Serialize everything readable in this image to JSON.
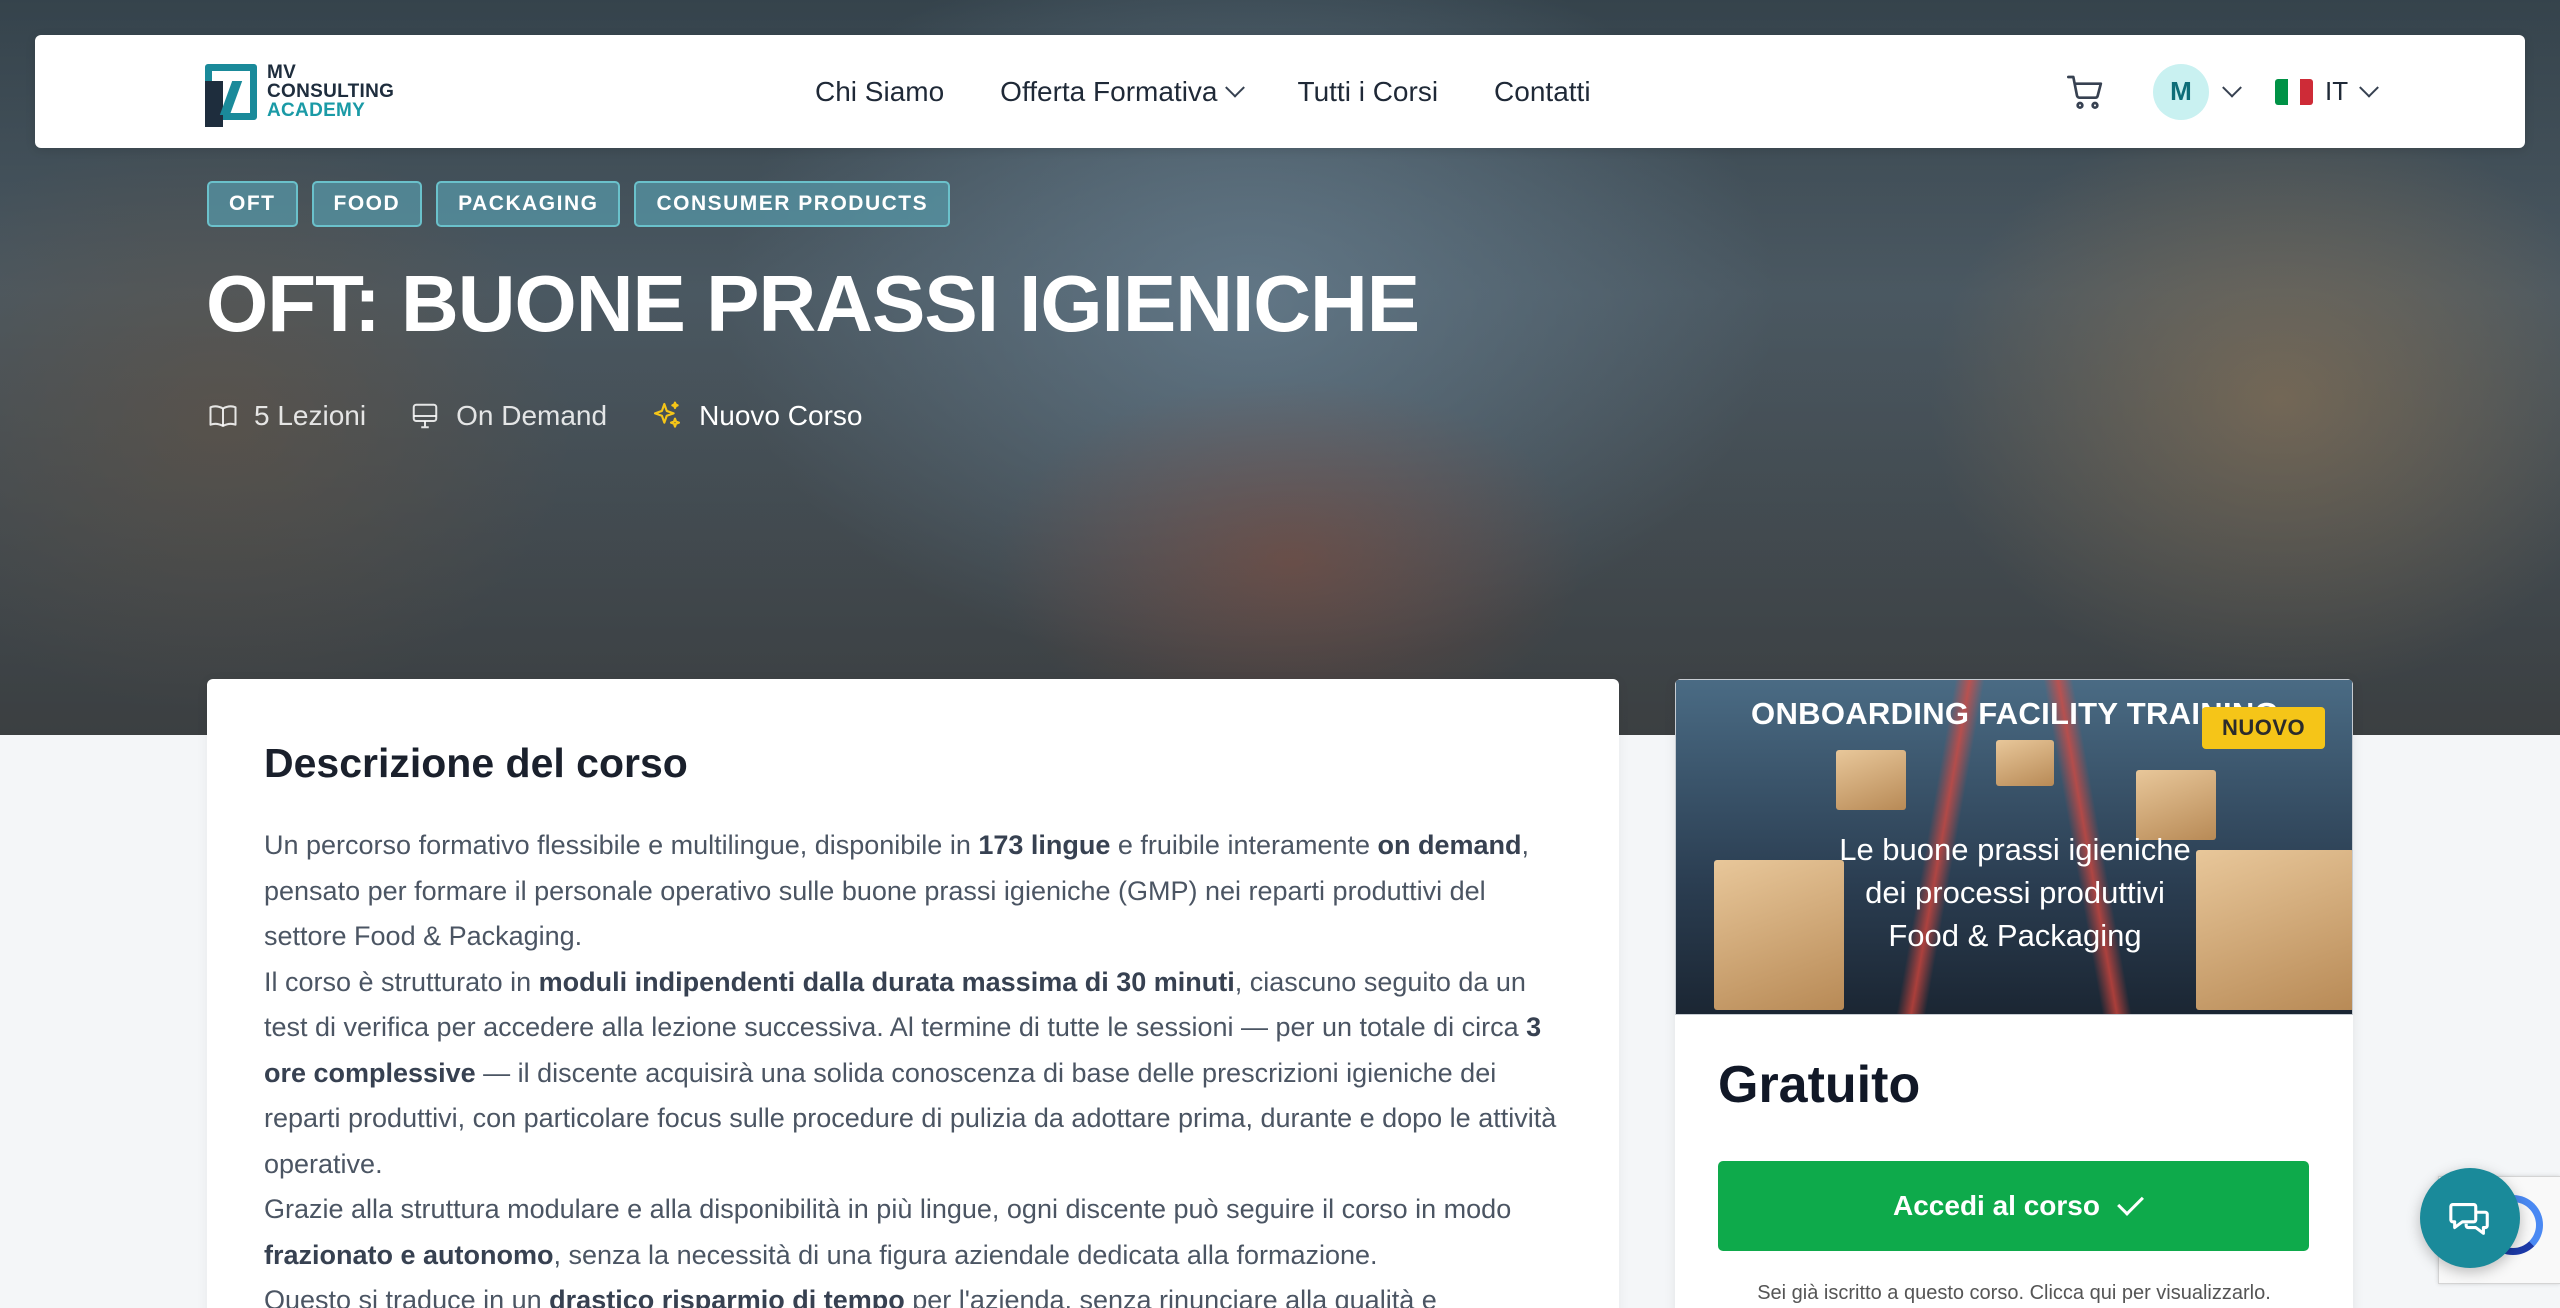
{
  "brand": {
    "logo_lines": [
      "MV",
      "CONSULTING",
      "ACADEMY"
    ],
    "accent_color": "#1a8a9a"
  },
  "nav": {
    "links": [
      {
        "label": "Chi Siamo",
        "has_dropdown": false
      },
      {
        "label": "Offerta Formativa",
        "has_dropdown": true
      },
      {
        "label": "Tutti i Corsi",
        "has_dropdown": false
      },
      {
        "label": "Contatti",
        "has_dropdown": false
      }
    ],
    "cart_icon": "cart-icon",
    "user_initial": "M",
    "language": "IT",
    "flag_colors": [
      "#009246",
      "#ffffff",
      "#ce2b37"
    ]
  },
  "hero": {
    "tags": [
      "OFT",
      "FOOD",
      "PACKAGING",
      "CONSUMER PRODUCTS"
    ],
    "title": "OFT: BUONE PRASSI IGIENICHE",
    "meta": {
      "lessons": "5 Lezioni",
      "mode": "On Demand",
      "status": "Nuovo Corso"
    }
  },
  "description": {
    "title": "Descrizione del corso",
    "p1": [
      {
        "t": "Un percorso formativo flessibile e multilingue, disponibile in "
      },
      {
        "t": "173 lingue",
        "b": true
      },
      {
        "t": " e fruibile interamente "
      },
      {
        "t": "on demand",
        "b": true
      },
      {
        "t": ", pensato per formare il personale operativo sulle buone prassi igieniche (GMP) nei reparti produttivi del settore Food & Packaging."
      }
    ],
    "p2": [
      {
        "t": "Il corso è strutturato in "
      },
      {
        "t": "moduli indipendenti dalla durata massima di 30 minuti",
        "b": true
      },
      {
        "t": ", ciascuno seguito da un test di verifica per accedere alla lezione successiva. Al termine di tutte le sessioni — per un totale di circa "
      },
      {
        "t": "3 ore complessive",
        "b": true
      },
      {
        "t": " — il discente acquisirà una solida conoscenza di base delle prescrizioni igieniche dei reparti produttivi, con particolare focus sulle procedure di pulizia da adottare prima, durante e dopo le attività operative."
      }
    ],
    "p3": [
      {
        "t": "Grazie alla struttura modulare e alla disponibilità in più lingue, ogni discente può seguire il corso in modo "
      },
      {
        "t": "frazionato e autonomo",
        "b": true
      },
      {
        "t": ", senza la necessità di una figura aziendale dedicata alla formazione."
      }
    ],
    "p4": [
      {
        "t": "Questo si traduce in un "
      },
      {
        "t": "drastico risparmio di tempo",
        "b": true
      },
      {
        "t": " per l'azienda, senza rinunciare alla qualità e"
      }
    ]
  },
  "course_card": {
    "thumb_title": "ONBOARDING FACILITY TRAINING",
    "thumb_subtitle": [
      "Le buone prassi igieniche",
      "dei processi produttivi",
      "Food & Packaging"
    ],
    "badge": "NUOVO",
    "price": "Gratuito",
    "cta_label": "Accedi al corso",
    "enrolled_note": "Sei già iscritto a questo corso. Clicca qui per visualizzarlo.",
    "cta_color": "#0eaa4b"
  },
  "chat": {
    "icon": "chat-bubbles-icon"
  }
}
